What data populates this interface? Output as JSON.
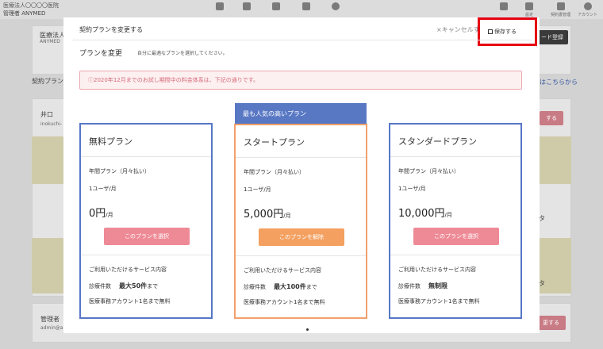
{
  "background": {
    "org_name": "医療法人〇〇〇〇医院",
    "role_label": "管理者",
    "role_value": "ANYMED",
    "nav_items": [
      {
        "icon": "home-icon",
        "label": ""
      },
      {
        "icon": "calendar-icon",
        "label": ""
      },
      {
        "icon": "users-icon",
        "label": ""
      },
      {
        "icon": "document-icon",
        "label": ""
      },
      {
        "icon": "circle-icon",
        "label": ""
      }
    ],
    "right_nav": [
      {
        "icon": "doc-icon",
        "label": ""
      },
      {
        "icon": "settings-icon",
        "label": "設定"
      },
      {
        "icon": "folder-icon",
        "label": "契約書管理"
      },
      {
        "icon": "account-icon",
        "label": "アカウント"
      }
    ],
    "card1_title": "医療法人",
    "card1_sub": "ANYMED",
    "card1_button": "ード登録",
    "section_label": "契約プラン",
    "link_text": "はこちらから",
    "user_name": "井口",
    "user_email": "inokuchi-",
    "user_button": "する",
    "side_char1": "タ",
    "side_char2": "タ",
    "bottom_title": "管理者",
    "bottom_email": "admin@a",
    "bottom_button": "更する"
  },
  "modal": {
    "title": "契約プランを変更する",
    "cancel_label": "×キャンセルす",
    "save_label": "保存する",
    "section_title": "プランを変更",
    "section_subtitle": "自分に最適なプランを選択してください。",
    "notice": "ⓘ2020年12月までのお試し期間中の料金体系は、下記の通りです。",
    "popular_label": "最も人気の高いプラン",
    "plans": [
      {
        "name": "無料プラン",
        "billing": "年間プラン（月々払い）",
        "unit": "1ユーザ/月",
        "price": "0円",
        "per": "/月",
        "button": "このプランを選択",
        "service_title": "ご利用いただけるサービス内容",
        "count_label": "診療件数",
        "count_value": "最大50件",
        "count_suffix": "まで",
        "account": "医療事務アカウント1名まで無料"
      },
      {
        "name": "スタートプラン",
        "billing": "年間プラン（月々払い）",
        "unit": "1ユーザ/月",
        "price": "5,000円",
        "per": "/月",
        "button": "このプランを解除",
        "service_title": "ご利用いただけるサービス内容",
        "count_label": "診療件数",
        "count_value": "最大100件",
        "count_suffix": "まで",
        "account": "医療事務アカウント1名まで無料"
      },
      {
        "name": "スタンダードプラン",
        "billing": "年間プラン（月々払い）",
        "unit": "1ユーザ/月",
        "price": "10,000円",
        "per": "/月",
        "button": "このプランを選択",
        "service_title": "ご利用いただけるサービス内容",
        "count_label": "診療件数",
        "count_value": "無制限",
        "count_suffix": "",
        "account": "医療事務アカウント1名まで無料"
      }
    ]
  },
  "colors": {
    "highlight_border": "#e60012",
    "plan_border_blue": "#5677c6",
    "plan_border_orange": "#f2a06b",
    "button_pink": "#ee8a96",
    "button_orange": "#f3a060",
    "popular_banner": "#5978c4"
  }
}
